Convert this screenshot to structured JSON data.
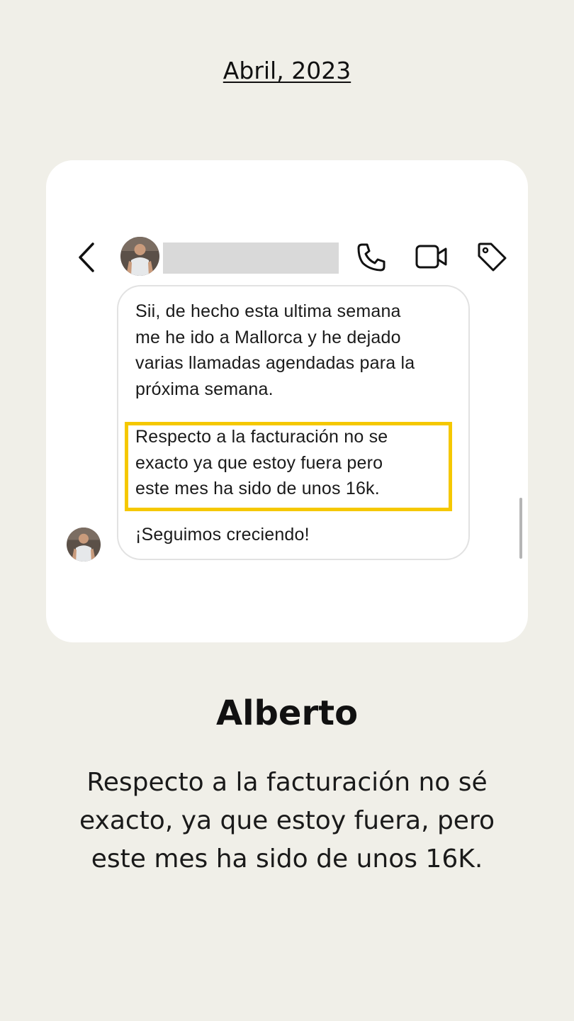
{
  "header": {
    "date_label": "Abril, 2023"
  },
  "chat": {
    "icons": {
      "back": "chevron-left-icon",
      "call": "phone-icon",
      "video": "video-camera-icon",
      "tag": "tag-icon"
    },
    "messages": [
      "Sii, de hecho esta ultima semana\nme he ido a Mallorca y he dejado\nvarias llamadas agendadas para la\npróxima semana.",
      "Respecto a la facturación no se\nexacto ya que estoy fuera pero\neste mes ha sido de unos 16k.",
      "¡Seguimos creciendo!"
    ],
    "highlight_color": "#f5c800"
  },
  "testimonial": {
    "name": "Alberto",
    "quote": "Respecto a la facturación no sé exacto, ya que estoy fuera, pero este mes ha sido de unos 16K."
  }
}
